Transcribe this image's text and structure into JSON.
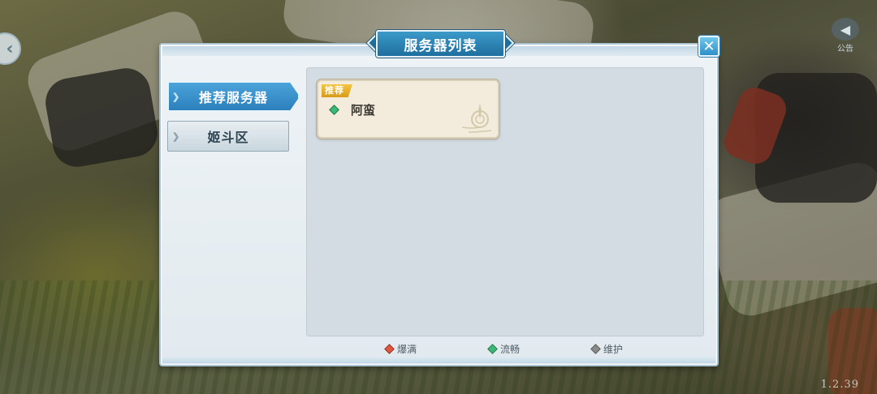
{
  "title": "服务器列表",
  "notice": {
    "label": "公告"
  },
  "version": "1.2.39",
  "tabs": [
    {
      "label": "推荐服务器",
      "active": true
    },
    {
      "label": "姬斗区",
      "active": false
    }
  ],
  "servers": [
    {
      "badge": "推荐",
      "name": "阿蛮",
      "status": "流畅",
      "status_color": "#3cb979"
    }
  ],
  "legend": [
    {
      "label": "爆满",
      "color": "#e0553d"
    },
    {
      "label": "流畅",
      "color": "#3cb979"
    },
    {
      "label": "维护",
      "color": "#8a8a8a"
    }
  ],
  "colors": {
    "accent": "#2a7dba",
    "panel_bg": "#e2eaef",
    "card_bg": "#f3ecdd",
    "badge": "#e7ab27"
  },
  "icons": {
    "back": "chevron-left-icon",
    "notice": "speaker-icon",
    "close": "close-icon"
  }
}
